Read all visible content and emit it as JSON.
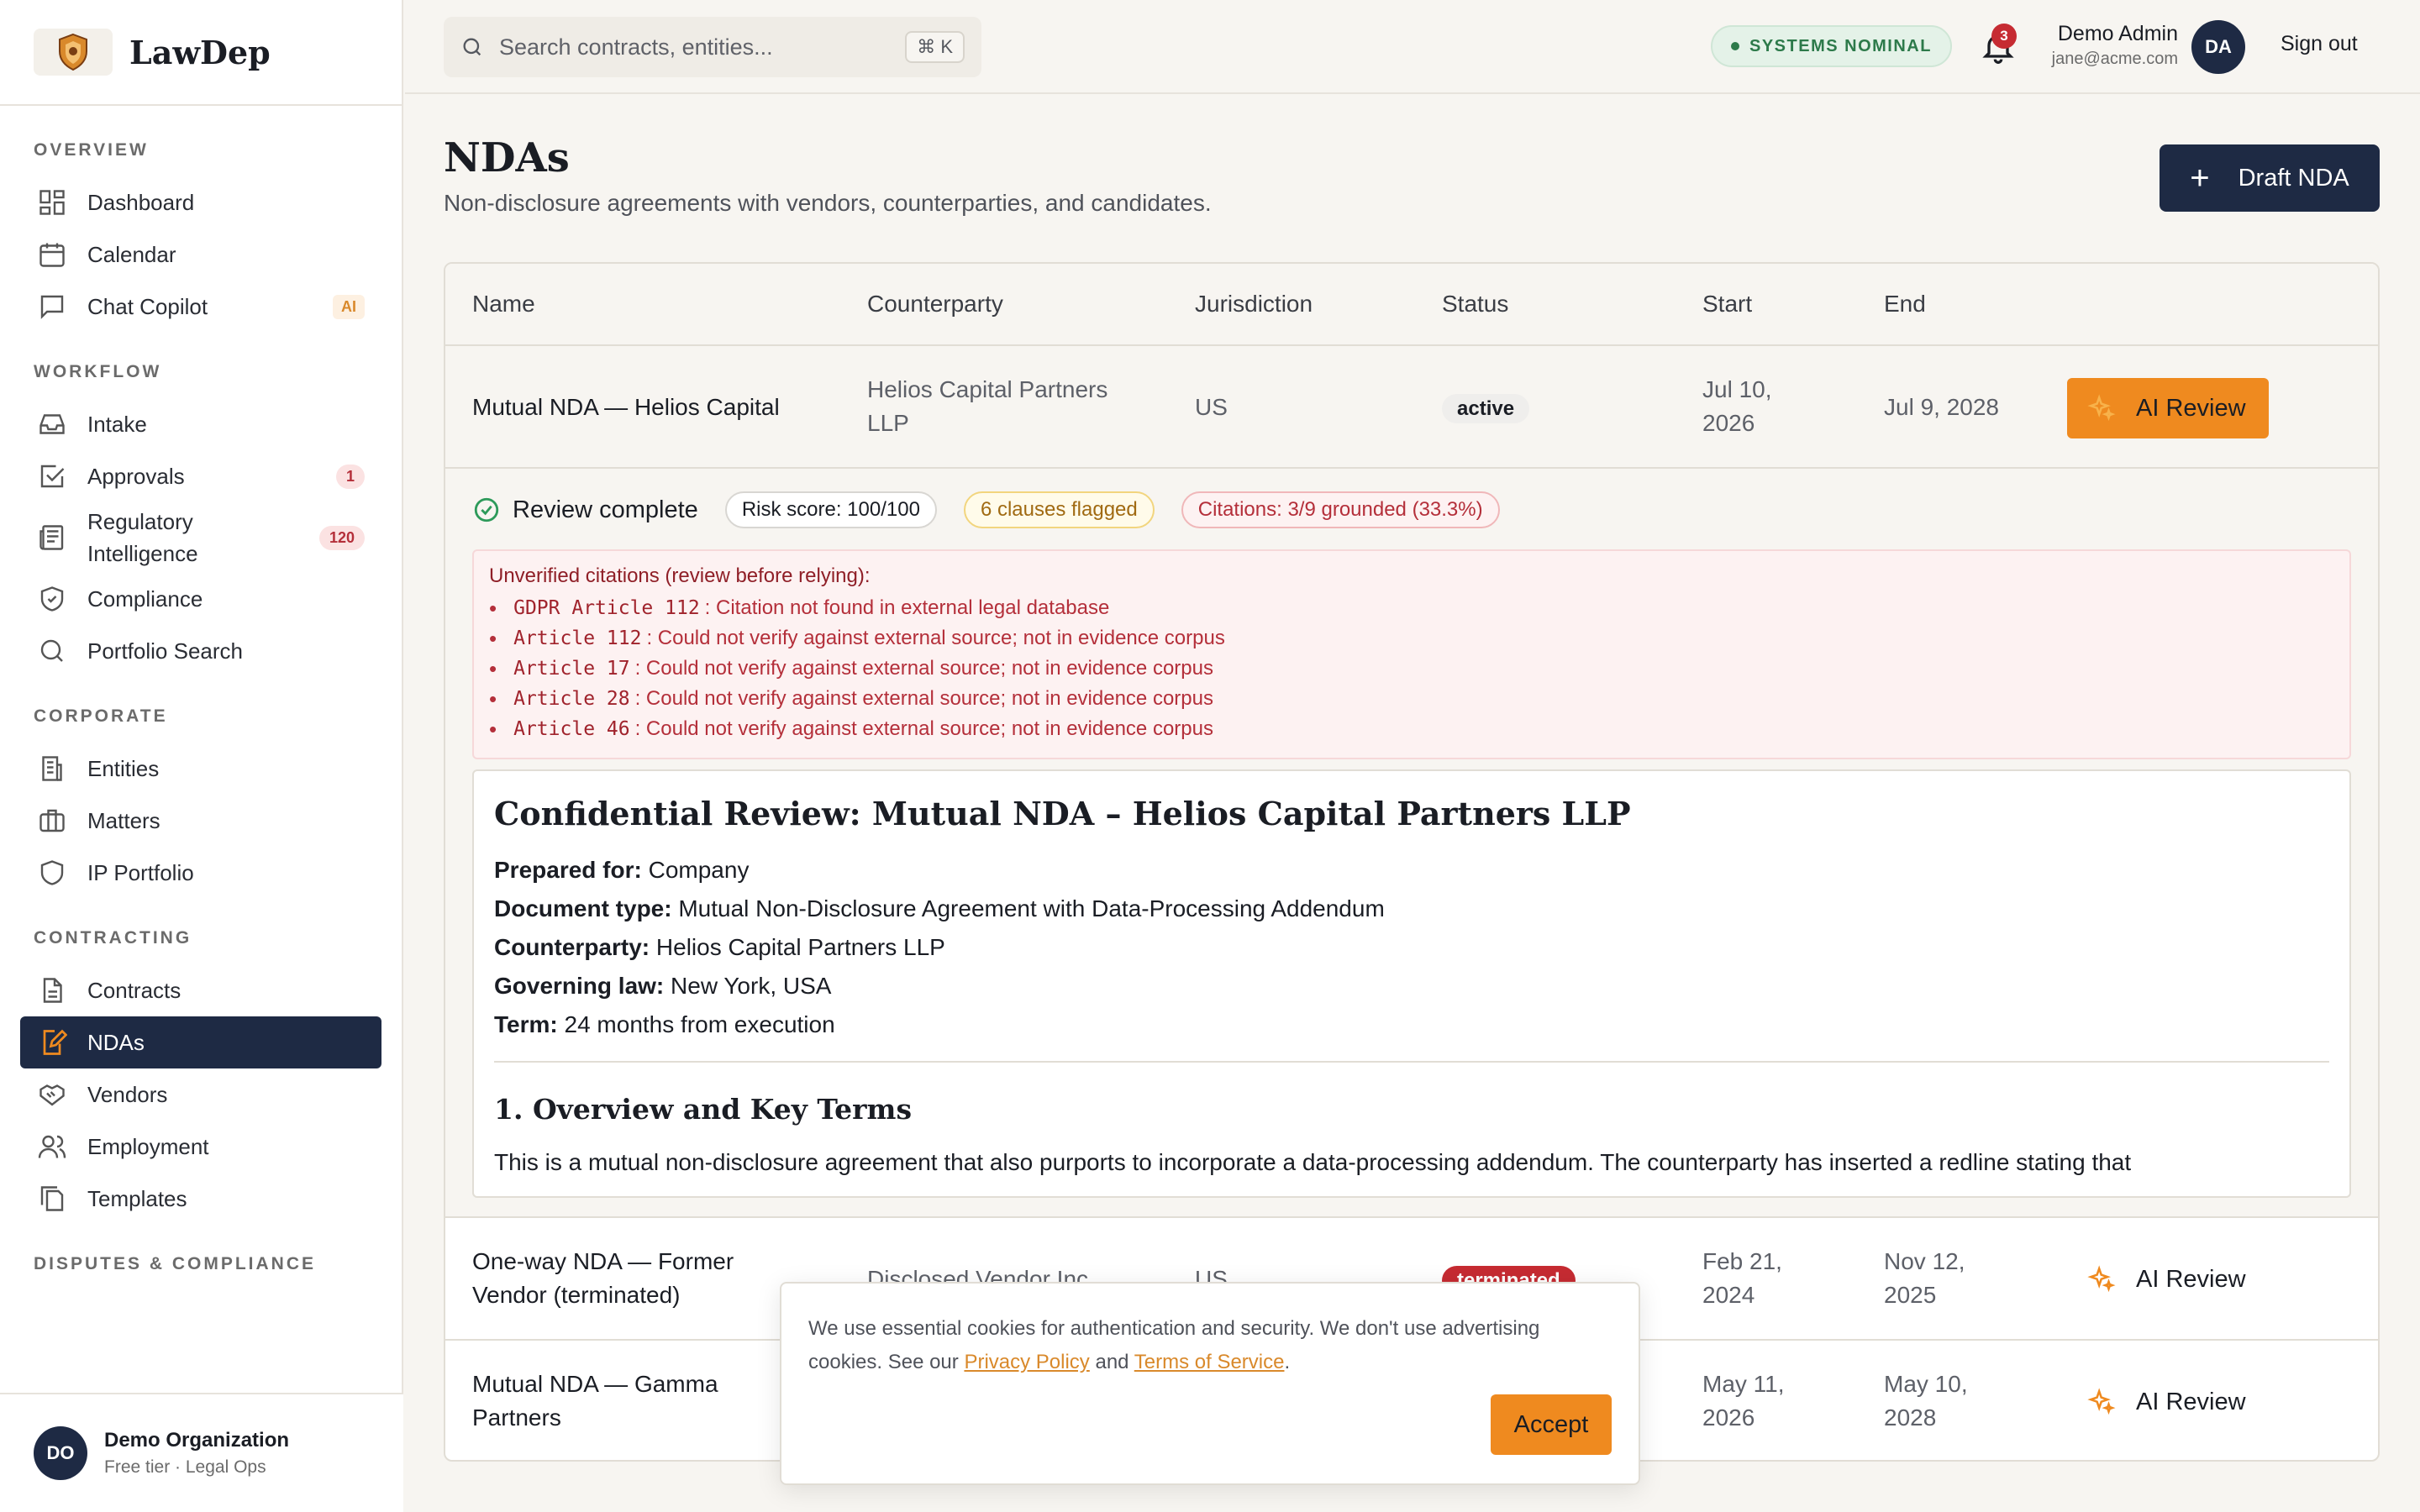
{
  "brand": {
    "name": "LawDep"
  },
  "sidebar": {
    "sections": {
      "overview": "OVERVIEW",
      "workflow": "WORKFLOW",
      "corporate": "CORPORATE",
      "contracting": "CONTRACTING",
      "disputes": "DISPUTES & COMPLIANCE"
    },
    "items": {
      "dashboard": "Dashboard",
      "calendar": "Calendar",
      "chat": "Chat Copilot",
      "chat_badge": "AI",
      "intake": "Intake",
      "approvals": "Approvals",
      "approvals_badge": "1",
      "regulatory": "Regulatory Intelligence",
      "regulatory_badge": "120",
      "compliance": "Compliance",
      "portfolio": "Portfolio Search",
      "entities": "Entities",
      "matters": "Matters",
      "ip": "IP Portfolio",
      "contracts": "Contracts",
      "ndas": "NDAs",
      "vendors": "Vendors",
      "employment": "Employment",
      "templates": "Templates"
    },
    "org": {
      "initials": "DO",
      "name": "Demo Organization",
      "sub": "Free tier · Legal Ops"
    }
  },
  "topbar": {
    "search_placeholder": "Search contracts, entities...",
    "shortcut": "⌘ K",
    "status": "SYSTEMS NOMINAL",
    "notifications": "3",
    "user_name": "Demo Admin",
    "user_email": "jane@acme.com",
    "user_initials": "DA",
    "signout": "Sign out"
  },
  "page": {
    "title": "NDAs",
    "subtitle": "Non-disclosure agreements with vendors, counterparties, and candidates.",
    "draft_label": "Draft NDA"
  },
  "table": {
    "headers": {
      "name": "Name",
      "counterparty": "Counterparty",
      "jurisdiction": "Jurisdiction",
      "status": "Status",
      "start": "Start",
      "end": "End"
    },
    "rows": [
      {
        "name": "Mutual NDA — Helios Capital",
        "counterparty_line1": "Helios Capital Partners",
        "counterparty_line2": "LLP",
        "jurisdiction": "US",
        "status": "active",
        "start_line1": "Jul 10,",
        "start_line2": "2026",
        "end": "Jul 9, 2028",
        "action": "AI Review"
      },
      {
        "name_line1": "One-way NDA — Former",
        "name_line2": "Vendor (terminated)",
        "counterparty": "Disclosed Vendor Inc.",
        "jurisdiction": "US",
        "status": "terminated",
        "start_line1": "Feb 21,",
        "start_line2": "2024",
        "end_line1": "Nov 12,",
        "end_line2": "2025",
        "action": "AI Review"
      },
      {
        "name_line1": "Mutual NDA — Gamma",
        "name_line2": "Partners",
        "start_line1": "May 11,",
        "start_line2": "2026",
        "end_line1": "May 10,",
        "end_line2": "2028",
        "action": "AI Review"
      }
    ]
  },
  "review": {
    "title": "Review complete",
    "risk": "Risk score: 100/100",
    "clauses": "6 clauses flagged",
    "citations": "Citations: 3/9 grounded (33.3%)",
    "unverified_heading": "Unverified citations (review before relying):",
    "unverified": [
      {
        "code": "GDPR Article 112",
        "msg": ": Citation not found in external legal database"
      },
      {
        "code": "Article 112",
        "msg": ": Could not verify against external source; not in evidence corpus"
      },
      {
        "code": "Article 17",
        "msg": ": Could not verify against external source; not in evidence corpus"
      },
      {
        "code": "Article 28",
        "msg": ": Could not verify against external source; not in evidence corpus"
      },
      {
        "code": "Article 46",
        "msg": ": Could not verify against external source; not in evidence corpus"
      }
    ],
    "report": {
      "heading": "Confidential Review: Mutual NDA – Helios Capital Partners LLP",
      "prepared_label": "Prepared for:",
      "prepared": "Company",
      "doctype_label": "Document type:",
      "doctype": "Mutual Non-Disclosure Agreement with Data-Processing Addendum",
      "counterparty_label": "Counterparty:",
      "counterparty": "Helios Capital Partners LLP",
      "law_label": "Governing law:",
      "law": "New York, USA",
      "term_label": "Term:",
      "term": "24 months from execution",
      "section1": "1. Overview and Key Terms",
      "para1": "This is a mutual non-disclosure agreement that also purports to incorporate a data-processing addendum. The counterparty has inserted a redline stating that"
    }
  },
  "cookie": {
    "text1": "We use essential cookies for authentication and security. We don't use advertising cookies. See our ",
    "privacy": "Privacy Policy",
    "and": " and ",
    "terms": "Terms of Service",
    "dot": ".",
    "accept": "Accept"
  },
  "colors": {
    "navy": "#1e2a44",
    "accent": "#ef8a1f",
    "danger": "#c62b32",
    "success": "#2d7a4a"
  }
}
